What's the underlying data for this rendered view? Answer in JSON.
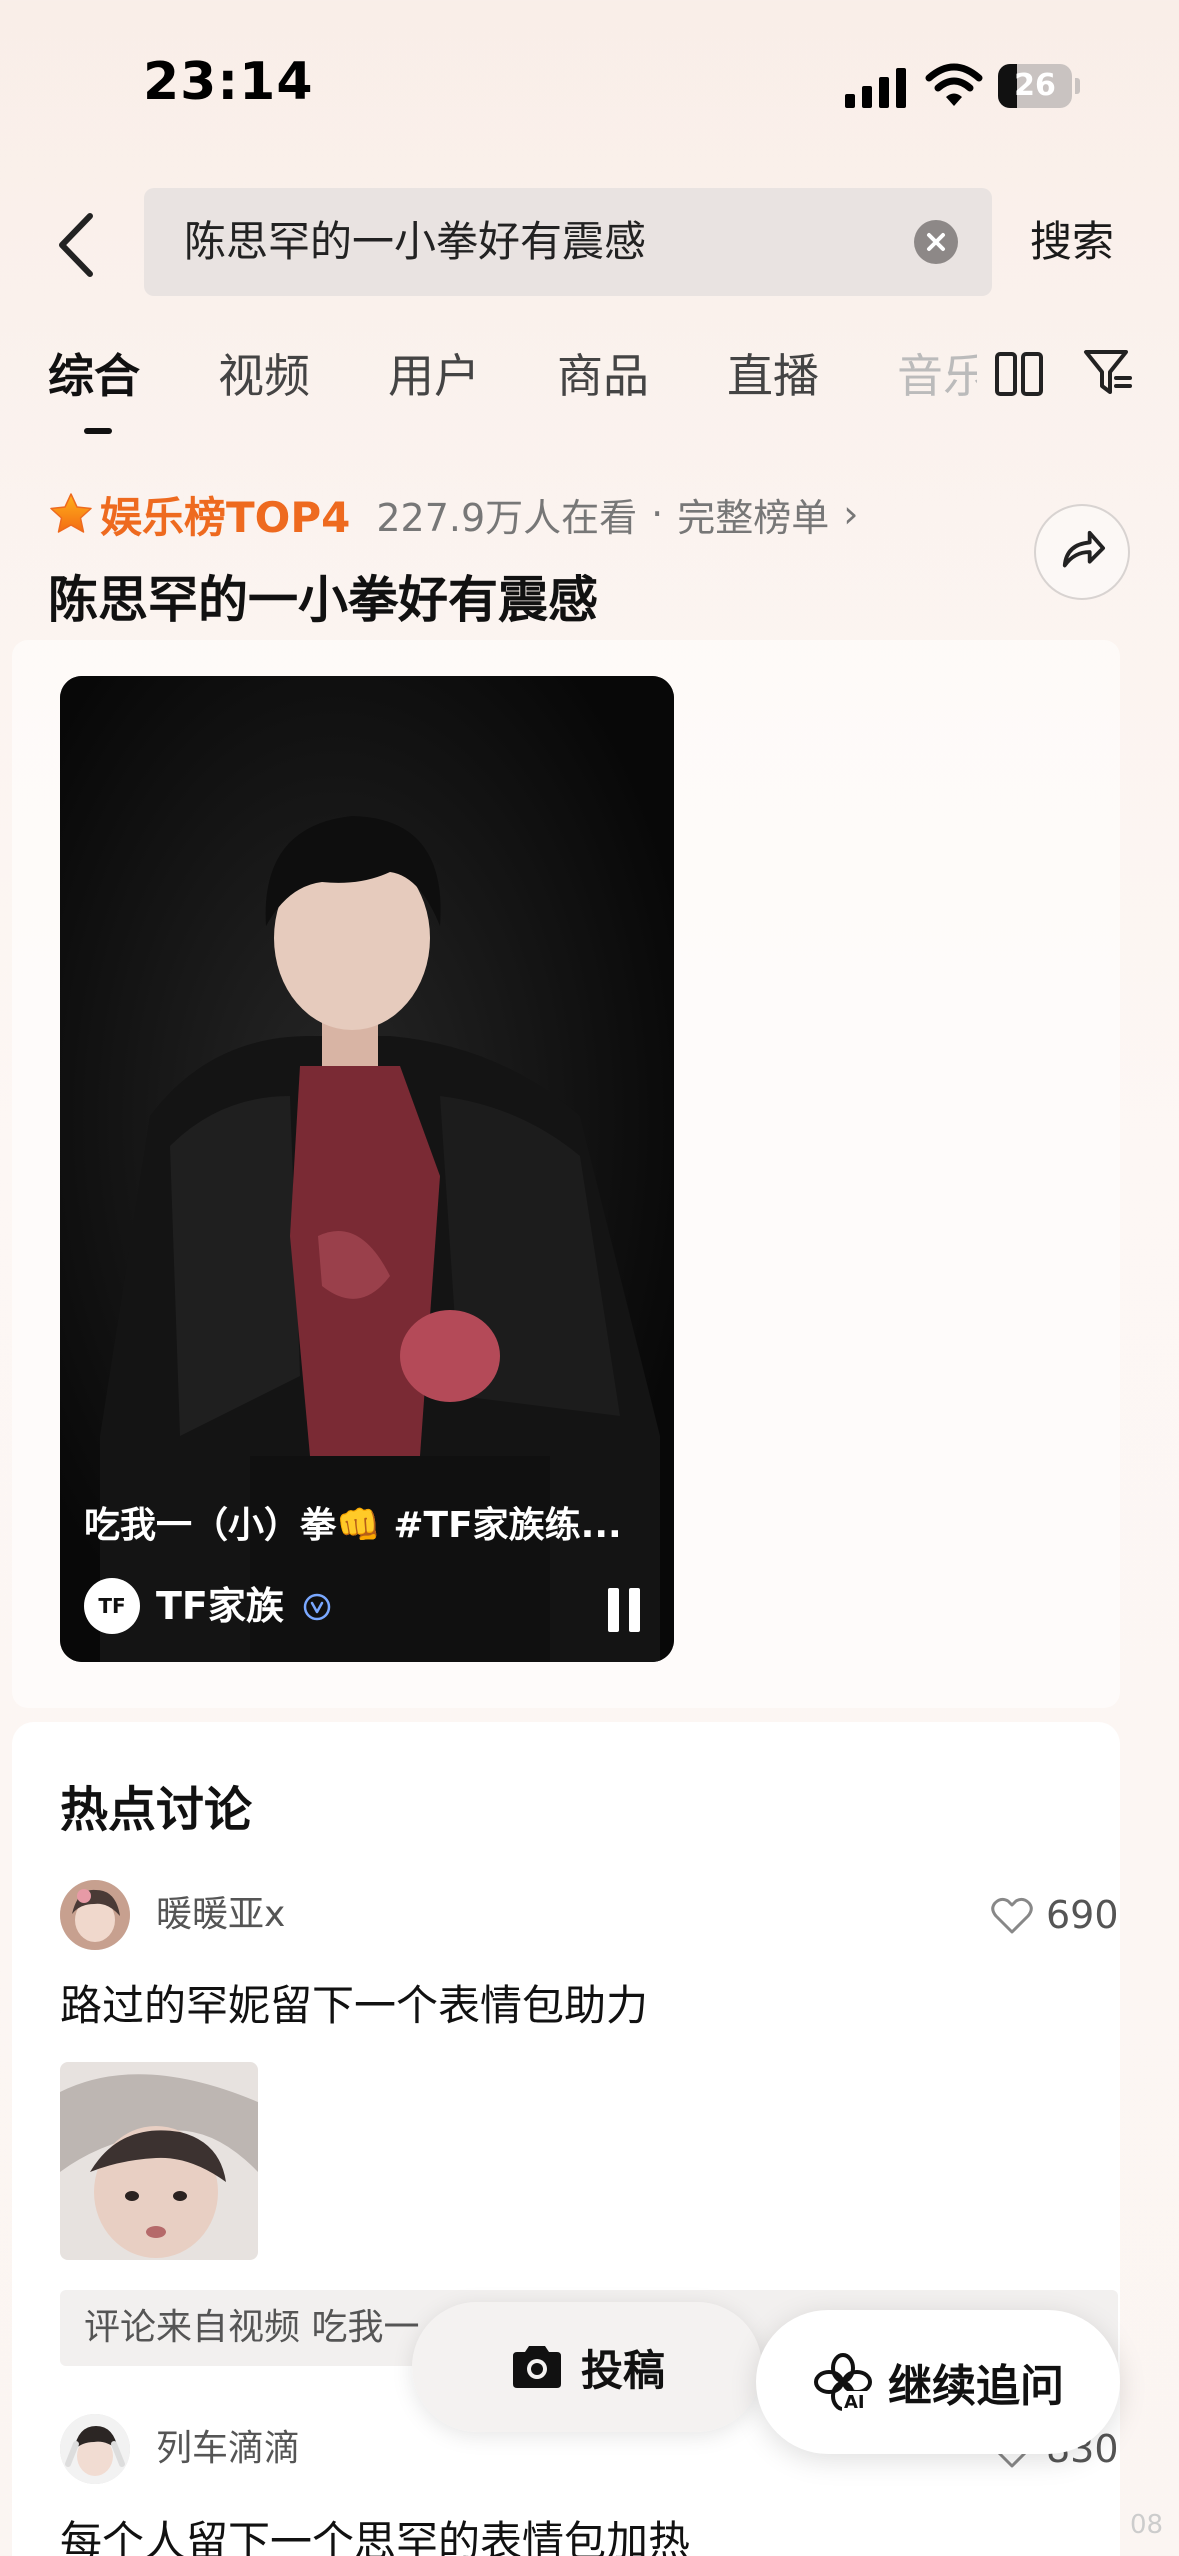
{
  "status_bar": {
    "time": "23:14",
    "battery": "26",
    "battery_level": 0.26
  },
  "search": {
    "query": "陈思罕的一小拳好有震感",
    "submit_label": "搜索"
  },
  "tabs": [
    {
      "label": "综合",
      "active": true
    },
    {
      "label": "视频",
      "active": false
    },
    {
      "label": "用户",
      "active": false
    },
    {
      "label": "商品",
      "active": false
    },
    {
      "label": "直播",
      "active": false
    },
    {
      "label": "音乐",
      "active": false
    }
  ],
  "ranking": {
    "label": "娱乐榜TOP4",
    "viewers": "227.9万人在看",
    "separator": "·",
    "full_list": "完整榜单",
    "chevron": "›",
    "accent_color": "#ee6a1f"
  },
  "headline": "陈思罕的一小拳好有震感",
  "video": {
    "caption": "吃我一（小）拳👊 #TF家族练...",
    "channel_name": "TF家族",
    "channel_avatar_text": "TF",
    "verified_icon": "verified-v-icon"
  },
  "discussion": {
    "title": "热点讨论",
    "comments": [
      {
        "user": "暖暖亚x",
        "likes": "690",
        "text": "路过的罕妮留下一个表情包助力",
        "source": "评论来自视频 吃我一"
      },
      {
        "user": "列车滴滴",
        "likes": "830",
        "text": "每个人留下一个思罕的表情包加热"
      }
    ]
  },
  "floating": {
    "post_label": "投稿",
    "ai_label": "继续追问",
    "ai_badge": "AI"
  },
  "page_number": "08"
}
